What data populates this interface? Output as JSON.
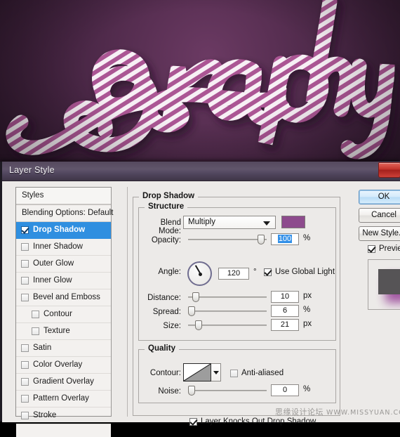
{
  "artwork": {
    "alt_text": "graphy candy-rope lettering on purple background",
    "background_color": "#4a2746",
    "rope_stripe_color": "#a8528f",
    "rope_base_color": "#f6eef4"
  },
  "dialog": {
    "title": "Layer Style",
    "close_label": ""
  },
  "styles_panel": {
    "header": "Styles",
    "items": [
      {
        "label": "Blending Options: Default",
        "checked": null,
        "selected": false,
        "sub": false
      },
      {
        "label": "Drop Shadow",
        "checked": true,
        "selected": true,
        "sub": false
      },
      {
        "label": "Inner Shadow",
        "checked": false,
        "selected": false,
        "sub": false
      },
      {
        "label": "Outer Glow",
        "checked": false,
        "selected": false,
        "sub": false
      },
      {
        "label": "Inner Glow",
        "checked": false,
        "selected": false,
        "sub": false
      },
      {
        "label": "Bevel and Emboss",
        "checked": false,
        "selected": false,
        "sub": false
      },
      {
        "label": "Contour",
        "checked": false,
        "selected": false,
        "sub": true
      },
      {
        "label": "Texture",
        "checked": false,
        "selected": false,
        "sub": true
      },
      {
        "label": "Satin",
        "checked": false,
        "selected": false,
        "sub": false
      },
      {
        "label": "Color Overlay",
        "checked": false,
        "selected": false,
        "sub": false
      },
      {
        "label": "Gradient Overlay",
        "checked": false,
        "selected": false,
        "sub": false
      },
      {
        "label": "Pattern Overlay",
        "checked": false,
        "selected": false,
        "sub": false
      },
      {
        "label": "Stroke",
        "checked": false,
        "selected": false,
        "sub": false
      }
    ]
  },
  "main": {
    "group_title": "Drop Shadow",
    "structure": {
      "legend": "Structure",
      "blend_mode_label": "Blend Mode:",
      "blend_mode_value": "Multiply",
      "blend_color": "#8d4b8d",
      "opacity_label": "Opacity:",
      "opacity_value": "100",
      "opacity_unit": "%",
      "angle_label": "Angle:",
      "angle_value": "120",
      "angle_unit": "°",
      "use_global_light_label": "Use Global Light",
      "use_global_light_checked": true,
      "distance_label": "Distance:",
      "distance_value": "10",
      "distance_unit": "px",
      "spread_label": "Spread:",
      "spread_value": "6",
      "spread_unit": "%",
      "size_label": "Size:",
      "size_value": "21",
      "size_unit": "px"
    },
    "quality": {
      "legend": "Quality",
      "contour_label": "Contour:",
      "anti_aliased_label": "Anti-aliased",
      "anti_aliased_checked": false,
      "noise_label": "Noise:",
      "noise_value": "0",
      "noise_unit": "%"
    },
    "knocks_out_label": "Layer Knocks Out Drop Shadow",
    "knocks_out_checked": true
  },
  "buttons": {
    "ok": "OK",
    "cancel": "Cancel",
    "new_style": "New Style...",
    "preview_label": "Preview",
    "preview_checked": true
  },
  "watermark": {
    "site_cn": "思缘设计论坛",
    "url": "WWW.MISSYUAN.COM"
  }
}
